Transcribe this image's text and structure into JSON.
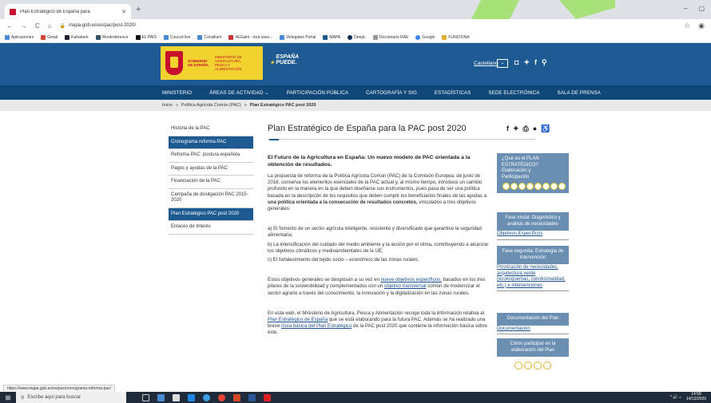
{
  "browser": {
    "tab_title": "Plan Estratégico de España para",
    "url": "mapa.gob.es/es/pac/post-2020/",
    "bookmarks": [
      "Aplicaciones",
      "Gmail",
      "Kahaberk",
      "Wordreference",
      "EL PAÍS",
      "Council live",
      "Consilium",
      "#EGalm - tout savo...",
      "Delegates Portal",
      "MAPA",
      "DeepL",
      "Diccionario RAE",
      "Google",
      "FUNCIONA"
    ],
    "status_url": "https://www.mapa.gob.es/es/pac/cronograma-reforma-pac/"
  },
  "header": {
    "gobierno": "GOBIERNO DE ESPAÑA",
    "ministerio": "MINISTERIO DE AGRICULTURA, PESCA Y ALIMENTACIÓN",
    "slogan": "ESPAÑA PUEDE.",
    "language": "Castellano"
  },
  "nav": [
    "MINISTERIO",
    "ÁREAS DE ACTIVIDAD ⌄",
    "PARTICIPACIÓN PÚBLICA",
    "CARTOGRAFÍA Y SIG",
    "ESTADÍSTICAS",
    "SEDE ELECTRÓNICA",
    "SALA DE PRENSA"
  ],
  "breadcrumb": {
    "home": "Inicio",
    "sep": "»",
    "level1": "Política Agrícola Común (PAC)",
    "current": "Plan Estratégico PAC post 2020"
  },
  "left_menu": [
    "Historia de la PAC",
    "Cronograma reforma PAC",
    "Reforma PAC: postura española",
    "Pagos y ayudas de la PAC",
    "Financiación de la PAC",
    "Campaña de divulgación PAC 2015-2020",
    "Plan Estratégico PAC post 2020",
    "Enlaces de Interés"
  ],
  "page_title": "Plan Estratégico de España para la PAC post 2020",
  "content": {
    "heading": "El Futuro de la Agricultura en España: Un nuevo modelo de PAC orientada a la obtención de resultados.",
    "p1_a": "La propuesta de reforma de la Política Agrícola Común (PAC) de la Comisión Europea, de junio de 2018, conserva los elementos esenciales de la PAC actual y, al mismo tiempo, introduce un cambio profundo en la manera en la que deben diseñarse sus instrumentos, pues pasa de ser una política basada en la descripción de los requisitos que deben cumplir los beneficiarios finales de las ayudas a",
    "p1_bold": "una política orientada a la consecución de resultados concretos,",
    "p1_b": "vinculados a tres objetivos generales:",
    "obj_a": "a) El fomento de un sector agrícola inteligente, resistente y diversificado que garantice la seguridad alimentaria;",
    "obj_b": "b) La intensificación del cuidado del medio ambiente y la acción por el clima, contribuyendo a alcanzar los objetivos climáticos y medioambientales de la UE;",
    "obj_c": "c) El fortalecimiento del tejido socio – económico de las zonas rurales.",
    "p2_a": "Estos objetivos generales se desglosan a su vez en",
    "p2_link1": "nueve objetivos específicos,",
    "p2_b": "basados en los tres pilares de la sostenibilidad y complementados con un",
    "p2_link2": "objetivo transversal",
    "p2_c": "común de modernizar el sector agrario a través del conocimiento, la innovación y la digitalización en las zonas rurales.",
    "p3_a": "En esta web, el Ministerio de Agricultura, Pesca y Alimentación recoge toda la información relativa al",
    "p3_link1": "Plan Estratégico de España",
    "p3_b": "que se está elaborando para la futura PAC. Además se ha realizado una breve",
    "p3_link2": "Guía básica del Plan Estratégico",
    "p3_c": "de la PAC post 2020 que contiene la información básica sobre éste."
  },
  "right_col": {
    "box1": "¿Qué es el PLAN ESTRATÉGICO? Elaboración y Participación",
    "box2": "Fase inicial: Diagnóstico y análisis de necesidades",
    "link2": "Objetivos Específicos",
    "box3": "Fase segunda: Estrategia de intervención",
    "link3": "Priorización de necesidades, arquitectura verde (ecoesquemas, condicionalidad, etc.) e intervenciones",
    "box4": "Documentación del Plan",
    "link4": "Documentación",
    "box5": "Cómo participar en la elaboración del Plan"
  },
  "taskbar": {
    "search_placeholder": "Escribe aquí para buscar",
    "time": "14:58",
    "date": "14/12/2020"
  },
  "colors": {
    "header_blue": "#1d5a92",
    "nav_blue": "#0f4878",
    "logo_yellow": "#f2d22e",
    "side_box": "#6a8fb3"
  }
}
